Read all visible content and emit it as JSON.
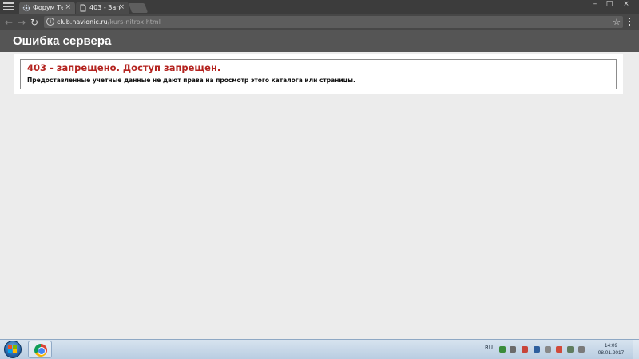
{
  "browser": {
    "tabs": [
      {
        "title": "Форум Те",
        "close": "×",
        "active": false
      },
      {
        "title": "403 - Запр",
        "close": "×",
        "active": true
      }
    ],
    "window_controls": {
      "minimize": "–",
      "maximize": "□",
      "close": "×"
    },
    "address": {
      "host": "club.navionic.ru",
      "path": "/kurs-nitrox.html"
    }
  },
  "page": {
    "header_title": "Ошибка сервера",
    "error_title": "403 - запрещено. Доступ запрещен.",
    "error_message": "Предоставленные учетные данные не дают права на просмотр этого каталога или страницы."
  },
  "taskbar": {
    "language": "RU",
    "time": "14:09",
    "date": "08.01.2017"
  },
  "colors": {
    "error_red": "#b4231f",
    "header_bg": "#555555",
    "page_bg": "#ececec"
  },
  "icons": [
    "menu-icon",
    "gear-favicon-icon",
    "page-favicon-icon",
    "back-icon",
    "forward-icon",
    "reload-icon",
    "info-icon",
    "star-icon",
    "kebab-menu-icon",
    "windows-logo-icon",
    "chrome-icon"
  ]
}
